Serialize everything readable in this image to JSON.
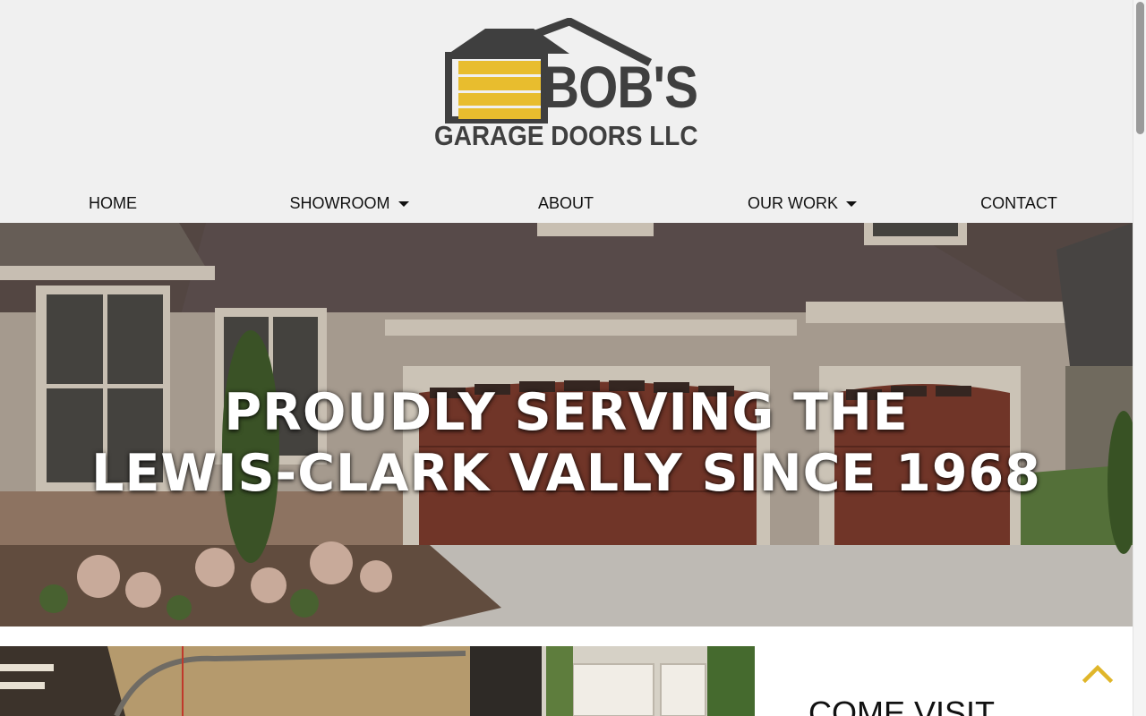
{
  "brand": {
    "name": "BOB'S",
    "subtitle": "GARAGE DOORS LLC",
    "colors": {
      "roof": "#3f3f3f",
      "door": "#e8bd2e"
    }
  },
  "nav": {
    "home": "HOME",
    "showroom": "SHOWROOM",
    "about": "ABOUT",
    "our_work": "OUR WORK",
    "contact": "CONTACT"
  },
  "hero": {
    "line1": "PROUDLY SERVING THE",
    "line2": "LEWIS-CLARK VALLY SINCE 1968"
  },
  "section": {
    "heading": "COME VISIT"
  },
  "back_to_top": {
    "icon": "chevron-up-icon",
    "color": "#e0b62a"
  }
}
